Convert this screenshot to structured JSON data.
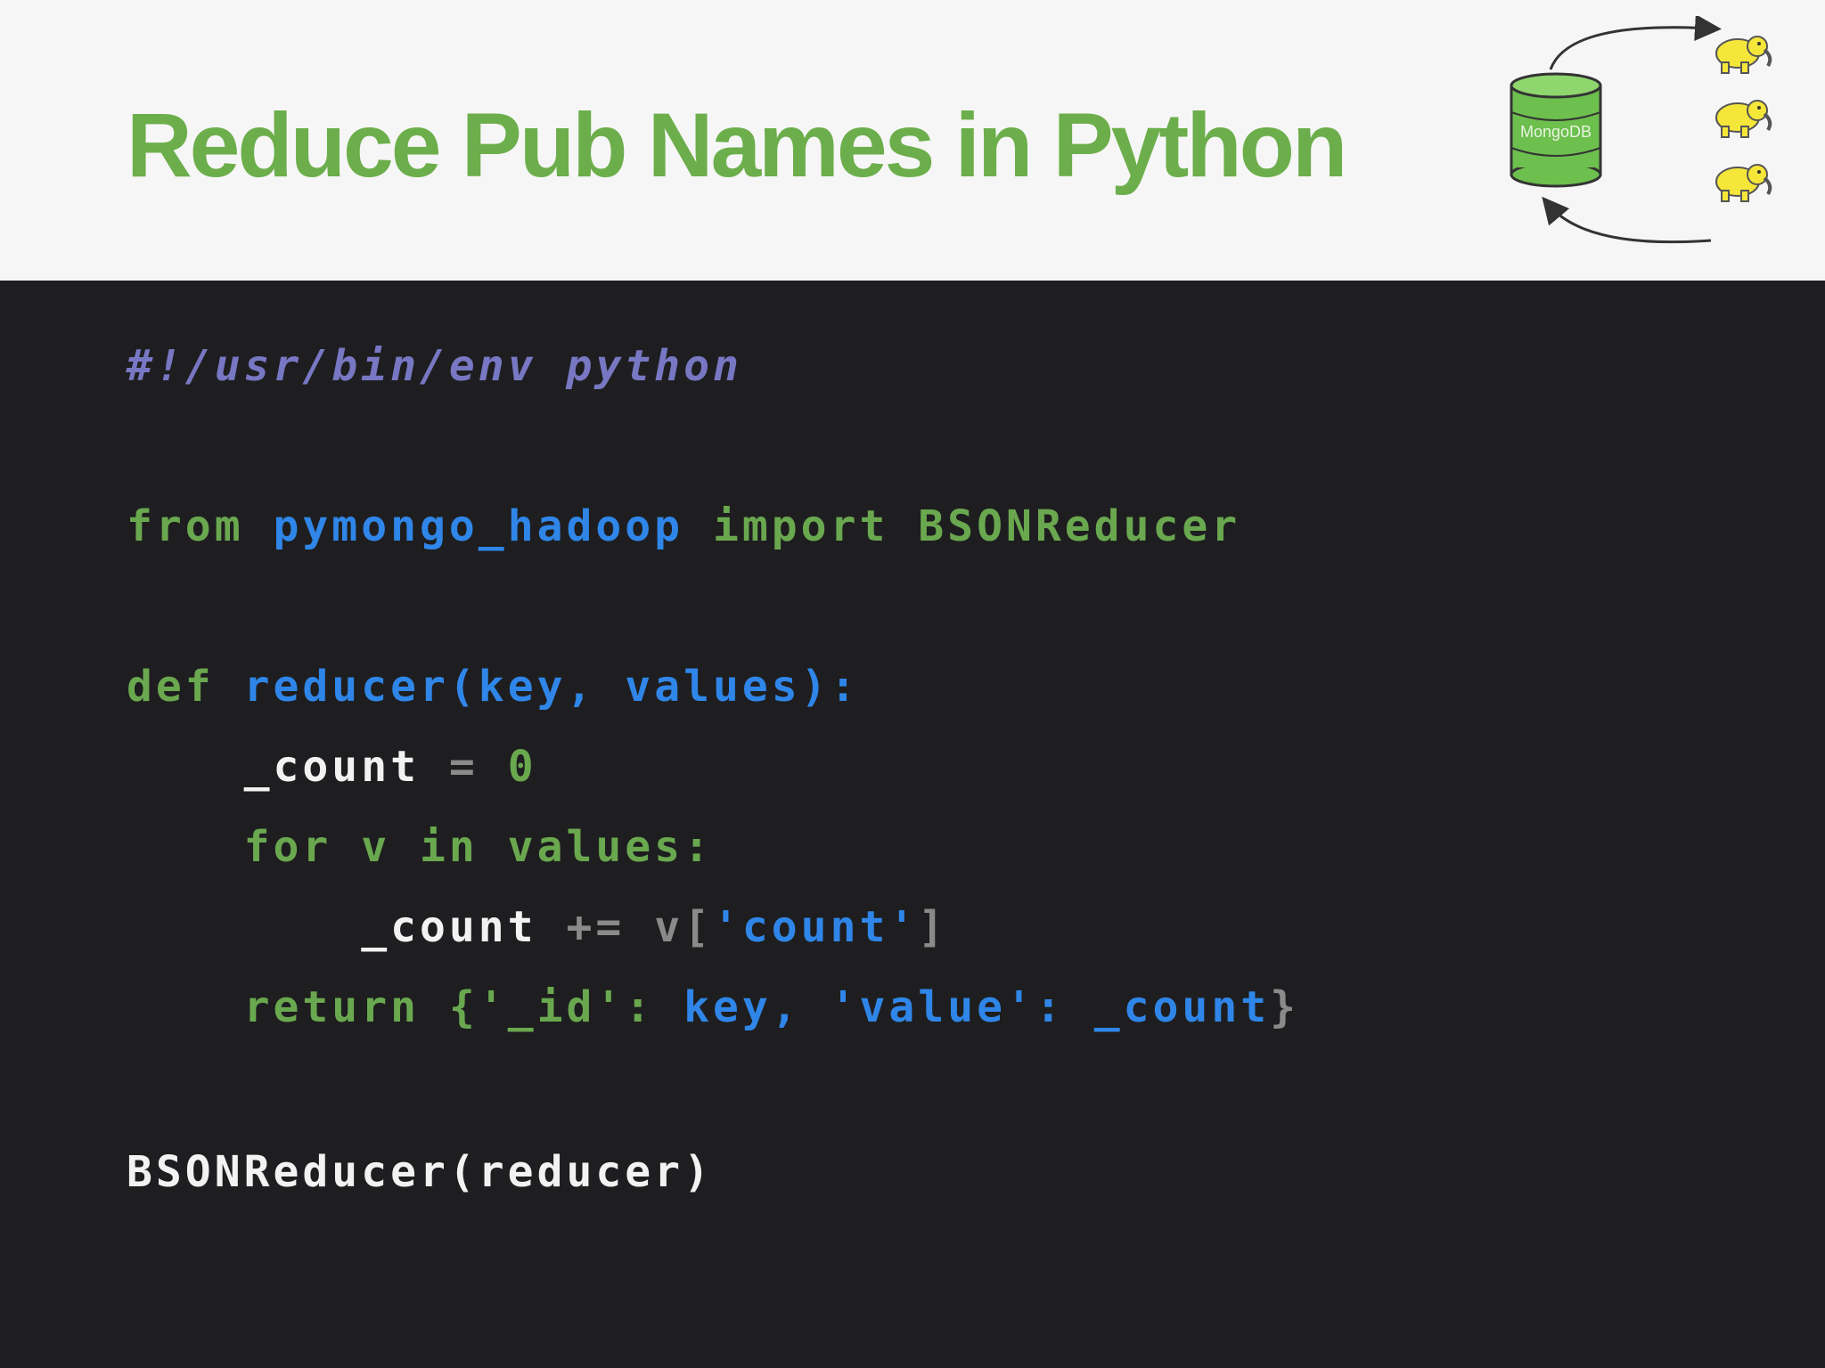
{
  "slide": {
    "title": "Reduce Pub Names in Python",
    "logo_text": "MongoDB"
  },
  "code": {
    "shebang": "#!/usr/bin/env python",
    "import_line": {
      "from": "from",
      "module": "pymongo_hadoop",
      "import": "import",
      "name": "BSONReducer"
    },
    "def_line": {
      "def": "def",
      "signature": "reducer(key, values):"
    },
    "count_init": {
      "var": "_count",
      "op": "=",
      "value": "0"
    },
    "for_line": "for v in values:",
    "count_add": {
      "var": "_count",
      "op": "+=",
      "v": "v[",
      "key": "'count'",
      "close": "]"
    },
    "return_line": {
      "kw": "return",
      "open": "{",
      "k1": "'_id'",
      "colon1": ":",
      "v1": "key,",
      "k2": "'value'",
      "colon2": ":",
      "v2": "_count",
      "close": "}"
    },
    "call_line": "BSONReducer(reducer)"
  },
  "colors": {
    "title": "#6cae4b",
    "header_bg": "#f6f6f6",
    "code_bg": "#1e1e20",
    "keyword": "#6aa84f",
    "identifier": "#2f86e8",
    "comment": "#7877c3",
    "text": "#f2f2f2",
    "mongodb_green": "#6dbf4e",
    "elephant_yellow": "#f5e63a"
  },
  "icons": [
    "mongodb-cylinder-icon",
    "hadoop-elephant-icon",
    "cycle-arrow-icon"
  ]
}
